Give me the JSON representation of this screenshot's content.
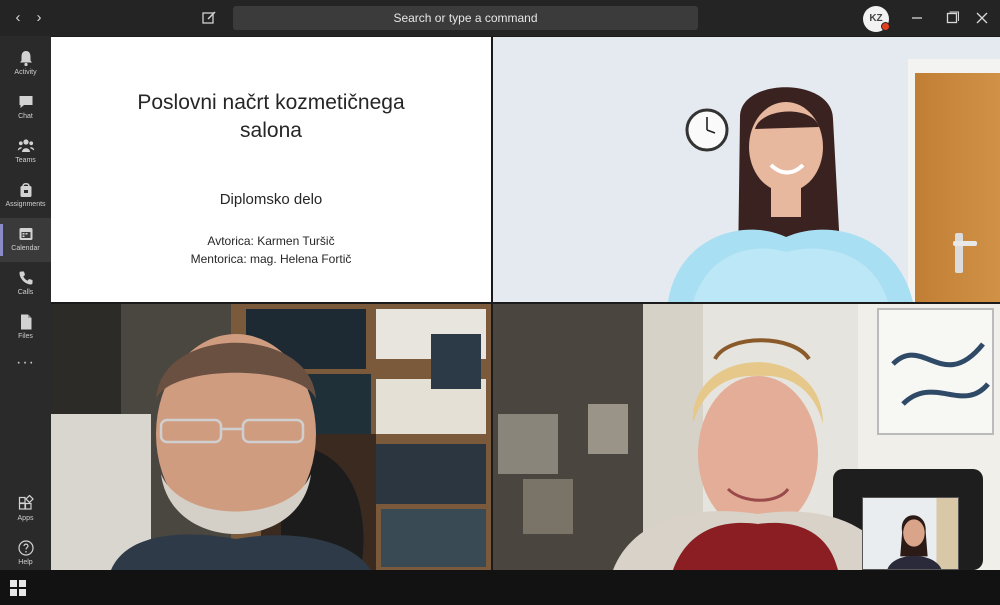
{
  "titlebar": {
    "back_glyph": "‹",
    "forward_glyph": "›",
    "search_text": "Search or type a command",
    "avatar_initials": "KZ",
    "icons": [
      "chevron-left-icon",
      "chevron-right-icon",
      "compose-icon",
      "minimize-icon",
      "maximize-icon",
      "close-icon"
    ]
  },
  "rail": {
    "items": [
      {
        "label": "Activity",
        "icon": "bell-icon"
      },
      {
        "label": "Chat",
        "icon": "chat-icon"
      },
      {
        "label": "Teams",
        "icon": "teams-icon"
      },
      {
        "label": "Assignments",
        "icon": "assignments-icon"
      },
      {
        "label": "Calendar",
        "icon": "calendar-icon",
        "active": true
      },
      {
        "label": "Calls",
        "icon": "phone-icon"
      },
      {
        "label": "Files",
        "icon": "file-icon"
      }
    ],
    "more_glyph": "···",
    "bottom": [
      {
        "label": "Apps",
        "icon": "apps-icon"
      },
      {
        "label": "Help",
        "icon": "help-icon"
      }
    ]
  },
  "slide": {
    "title_line1": "Poslovni načrt kozmetičnega",
    "title_line2": "salona",
    "subtitle": "Diplomsko delo",
    "author": "Avtorica: Karmen Turšič",
    "mentor": "Mentorica: mag. Helena Fortič"
  },
  "colors": {
    "titlebar": "#242424",
    "rail": "#2a2a2a",
    "rail_accent": "#8b8cc7",
    "status_dot": "#e2401c",
    "taskbar": "#121212"
  }
}
